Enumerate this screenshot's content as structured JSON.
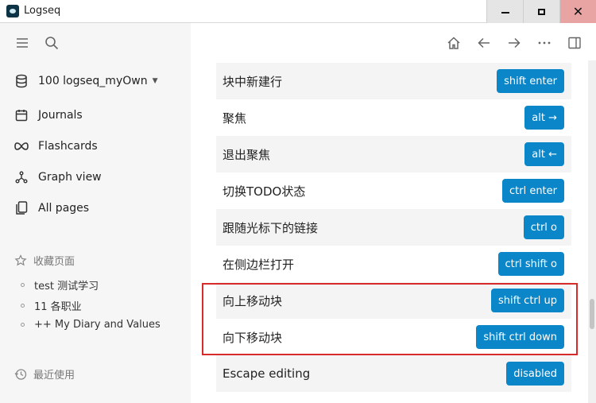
{
  "window": {
    "title": "Logseq",
    "close_glyph": "✕"
  },
  "sidebar": {
    "graph_name": "100 logseq_myOwn",
    "nav": [
      {
        "label": "Journals",
        "icon": "calendar-icon"
      },
      {
        "label": "Flashcards",
        "icon": "infinity-icon"
      },
      {
        "label": "Graph view",
        "icon": "graph-icon"
      },
      {
        "label": "All pages",
        "icon": "pages-icon"
      }
    ],
    "favorites_title": "收藏页面",
    "favorites": [
      "test 测试学习",
      "11 各职业",
      "++ My Diary and Values"
    ],
    "recent_title": "最近使用"
  },
  "shortcuts": [
    {
      "label": "块中新建行",
      "key": "shift enter"
    },
    {
      "label": "聚焦",
      "key": "alt →"
    },
    {
      "label": "退出聚焦",
      "key": "alt ←"
    },
    {
      "label": "切换TODO状态",
      "key": "ctrl enter"
    },
    {
      "label": "跟随光标下的链接",
      "key": "ctrl o"
    },
    {
      "label": "在侧边栏打开",
      "key": "ctrl shift o"
    },
    {
      "label": "向上移动块",
      "key": "shift ctrl up"
    },
    {
      "label": "向下移动块",
      "key": "shift ctrl down"
    },
    {
      "label": "Escape editing",
      "key": "disabled"
    }
  ],
  "colors": {
    "accent": "#0a86c9",
    "highlight_border": "#d72a2a",
    "sidebar_bg": "#f6f6f6"
  }
}
